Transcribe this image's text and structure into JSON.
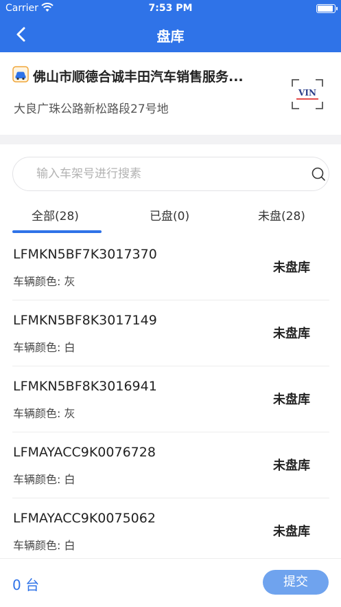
{
  "status_bar": {
    "carrier": "Carrier",
    "time": "7:53 PM"
  },
  "nav": {
    "title": "盘库"
  },
  "dealer": {
    "name": "佛山市顺德合诚丰田汽车销售服务...",
    "address": "大良广珠公路新松路段27号地",
    "vin_button_label": "VIN"
  },
  "search": {
    "placeholder": "输入车架号进行搜素"
  },
  "tabs": [
    {
      "label": "全部(28)",
      "active": true
    },
    {
      "label": "已盘(0)",
      "active": false
    },
    {
      "label": "未盘(28)",
      "active": false
    }
  ],
  "vehicles": [
    {
      "vin": "LFMKN5BF7K3017370",
      "color": "车辆颜色: 灰",
      "status": "未盘库"
    },
    {
      "vin": "LFMKN5BF8K3017149",
      "color": "车辆颜色: 白",
      "status": "未盘库"
    },
    {
      "vin": "LFMKN5BF8K3016941",
      "color": "车辆颜色: 灰",
      "status": "未盘库"
    },
    {
      "vin": "LFMAYACC9K0076728",
      "color": "车辆颜色: 白",
      "status": "未盘库"
    },
    {
      "vin": "LFMAYACC9K0075062",
      "color": "车辆颜色: 白",
      "status": "未盘库"
    }
  ],
  "footer": {
    "count": "0 台",
    "submit_label": "提交"
  },
  "colors": {
    "primary": "#2f73e8",
    "submit_bg": "#6fa3ee"
  }
}
